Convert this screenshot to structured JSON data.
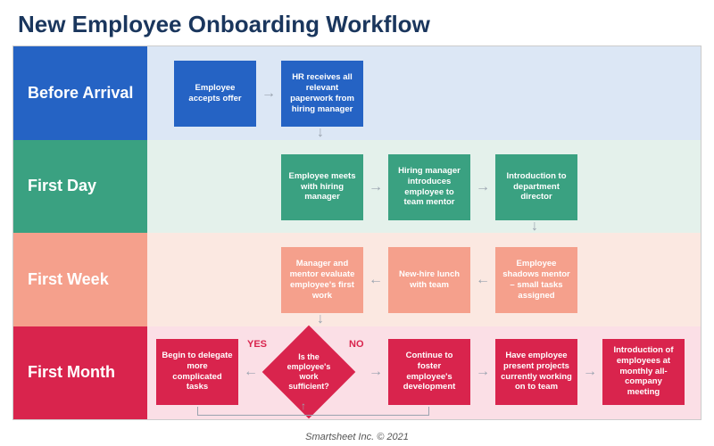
{
  "title": "New Employee Onboarding Workflow",
  "footer": "Smartsheet Inc. © 2021",
  "lanes": {
    "before_arrival": {
      "label": "Before Arrival",
      "steps": [
        "Employee accepts offer",
        "HR receives all relevant paperwork from hiring manager"
      ]
    },
    "first_day": {
      "label": "First Day",
      "steps": [
        "Employee meets with hiring manager",
        "Hiring manager introduces employee to team mentor",
        "Introduction to department director"
      ]
    },
    "first_week": {
      "label": "First Week",
      "steps": [
        "Manager and mentor evaluate employee's first work",
        "New-hire lunch with team",
        "Employee shadows mentor – small tasks assigned"
      ]
    },
    "first_month": {
      "label": "First Month",
      "decision": "Is the employee's work sufficient?",
      "yes_label": "YES",
      "no_label": "NO",
      "yes_path": [
        "Begin to delegate more complicated tasks"
      ],
      "no_path": [
        "Continue to foster employee's development",
        "Have employee present projects currently working on to team",
        "Introduction of employees at monthly all-company meeting"
      ]
    }
  }
}
